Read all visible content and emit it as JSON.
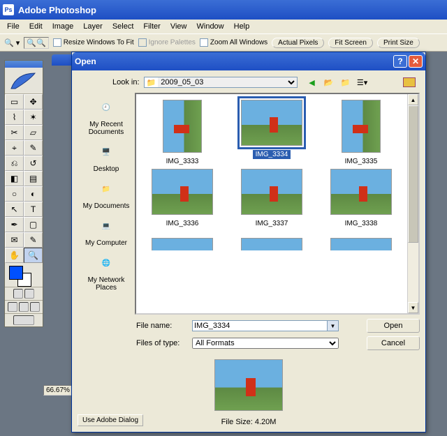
{
  "title": "Adobe Photoshop",
  "menu": [
    "File",
    "Edit",
    "Image",
    "Layer",
    "Select",
    "Filter",
    "View",
    "Window",
    "Help"
  ],
  "optionbar": {
    "resize": "Resize Windows To Fit",
    "ignore": "Ignore Palettes",
    "zoomall": "Zoom All Windows",
    "actual": "Actual Pixels",
    "fit": "Fit Screen",
    "print": "Print Size"
  },
  "zoomlabel": "66.67%",
  "dialog": {
    "title": "Open",
    "lookin_label": "Look in:",
    "lookin_value": "2009_05_03",
    "filename_label": "File name:",
    "filename_value": "IMG_3334",
    "filetype_label": "Files of type:",
    "filetype_value": "All Formats",
    "open_btn": "Open",
    "cancel_btn": "Cancel",
    "adobe_dlg": "Use Adobe Dialog",
    "filesize": "File Size: 4.20M",
    "places": [
      "My Recent Documents",
      "Desktop",
      "My Documents",
      "My Computer",
      "My Network Places"
    ],
    "files": [
      {
        "name": "IMG_3333",
        "rot": true
      },
      {
        "name": "IMG_3334",
        "sel": true
      },
      {
        "name": "IMG_3335",
        "rot": true
      },
      {
        "name": "IMG_3336"
      },
      {
        "name": "IMG_3337"
      },
      {
        "name": "IMG_3338"
      }
    ]
  }
}
